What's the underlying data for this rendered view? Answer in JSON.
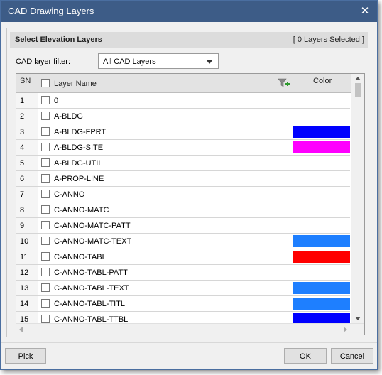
{
  "window": {
    "title": "CAD Drawing Layers"
  },
  "panel": {
    "title": "Select Elevation Layers",
    "selected_count": "[ 0 Layers Selected ]"
  },
  "filter": {
    "label": "CAD layer filter:",
    "value": "All CAD Layers"
  },
  "grid": {
    "headers": {
      "sn": "SN",
      "name": "Layer Name",
      "color": "Color"
    },
    "rows": [
      {
        "sn": "1",
        "name": "0",
        "color": ""
      },
      {
        "sn": "2",
        "name": "A-BLDG",
        "color": ""
      },
      {
        "sn": "3",
        "name": "A-BLDG-FPRT",
        "color": "#0000ff"
      },
      {
        "sn": "4",
        "name": "A-BLDG-SITE",
        "color": "#ff00ff"
      },
      {
        "sn": "5",
        "name": "A-BLDG-UTIL",
        "color": ""
      },
      {
        "sn": "6",
        "name": "A-PROP-LINE",
        "color": ""
      },
      {
        "sn": "7",
        "name": "C-ANNO",
        "color": ""
      },
      {
        "sn": "8",
        "name": "C-ANNO-MATC",
        "color": ""
      },
      {
        "sn": "9",
        "name": "C-ANNO-MATC-PATT",
        "color": ""
      },
      {
        "sn": "10",
        "name": "C-ANNO-MATC-TEXT",
        "color": "#1e7fff"
      },
      {
        "sn": "11",
        "name": "C-ANNO-TABL",
        "color": "#ff0000"
      },
      {
        "sn": "12",
        "name": "C-ANNO-TABL-PATT",
        "color": ""
      },
      {
        "sn": "13",
        "name": "C-ANNO-TABL-TEXT",
        "color": "#1e7fff"
      },
      {
        "sn": "14",
        "name": "C-ANNO-TABL-TITL",
        "color": "#1e7fff"
      },
      {
        "sn": "15",
        "name": "C-ANNO-TABL-TTBL",
        "color": "#0000ff"
      }
    ]
  },
  "buttons": {
    "pick": "Pick",
    "ok": "OK",
    "cancel": "Cancel"
  },
  "icons": {
    "close": "close-icon",
    "filter": "filter-add-icon",
    "dropdown": "chevron-down-icon"
  }
}
